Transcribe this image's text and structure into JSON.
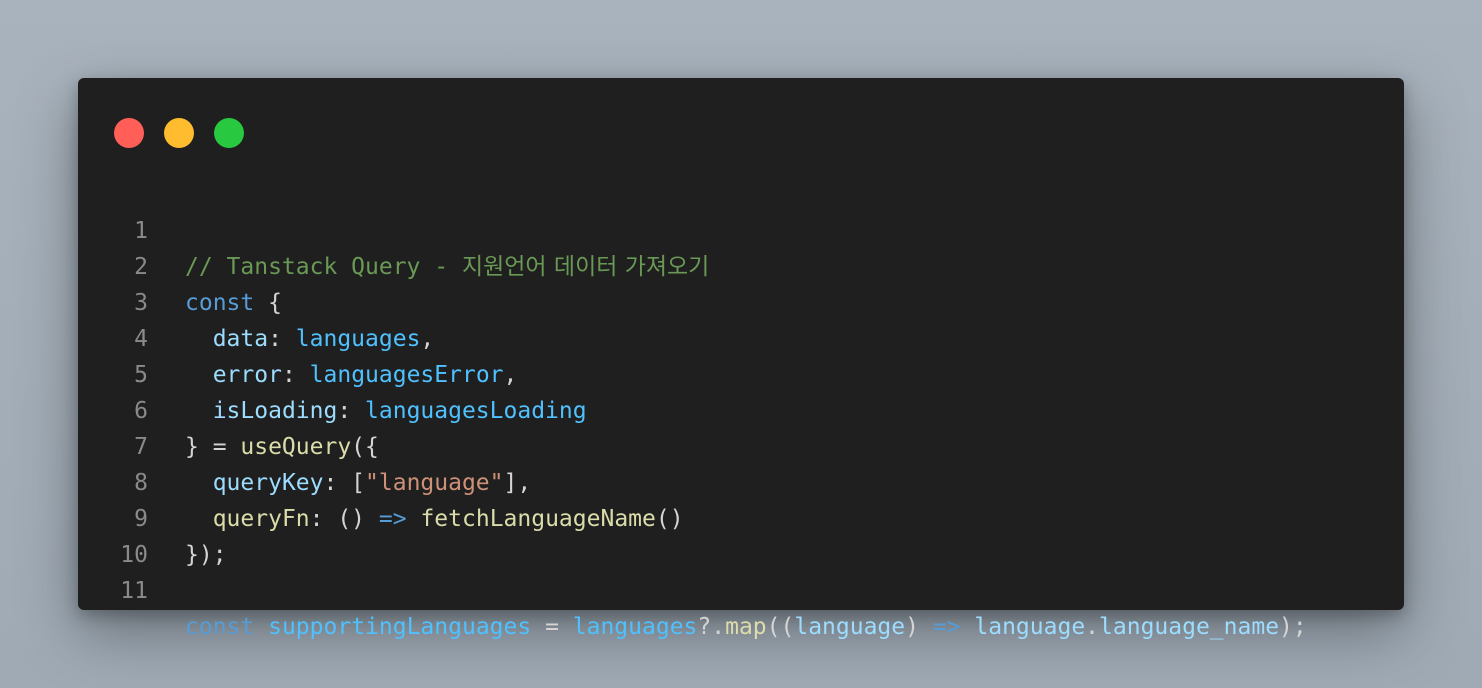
{
  "window": {
    "controls": [
      {
        "name": "close",
        "color": "#ff5f57"
      },
      {
        "name": "minimize",
        "color": "#febc2e"
      },
      {
        "name": "maximize",
        "color": "#28c840"
      }
    ]
  },
  "code": {
    "line_numbers": [
      "1",
      "2",
      "3",
      "4",
      "5",
      "6",
      "7",
      "8",
      "9",
      "10",
      "11"
    ],
    "line1": {
      "comment": "// Tanstack Query - ",
      "comment_ko": "지원언어 데이터 가져오기"
    },
    "line2": {
      "kw": "const",
      "punc": " {"
    },
    "line3": {
      "indent": "  ",
      "prop": "data",
      "colon": ": ",
      "var": "languages",
      "punc": ","
    },
    "line4": {
      "indent": "  ",
      "prop": "error",
      "colon": ": ",
      "var": "languagesError",
      "punc": ","
    },
    "line5": {
      "indent": "  ",
      "prop": "isLoading",
      "colon": ": ",
      "var": "languagesLoading"
    },
    "line6": {
      "punc1": "} = ",
      "fn": "useQuery",
      "punc2": "({"
    },
    "line7": {
      "indent": "  ",
      "prop": "queryKey",
      "colon": ": [",
      "str": "\"language\"",
      "punc": "],"
    },
    "line8": {
      "indent": "  ",
      "fn1": "queryFn",
      "colon": ": () ",
      "arrow": "=>",
      "space": " ",
      "fn2": "fetchLanguageName",
      "punc": "()"
    },
    "line9": {
      "punc": "});"
    },
    "line10": {
      "text": ""
    },
    "line11": {
      "kw": "const",
      "sp1": " ",
      "var1": "supportingLanguages",
      "eq": " = ",
      "var2": "languages",
      "op": "?.",
      "fn": "map",
      "open": "((",
      "param": "language",
      "close": ") ",
      "arrow": "=>",
      "sp2": " ",
      "obj": "language",
      "dot": ".",
      "prop": "language_name",
      "end": ");"
    }
  }
}
